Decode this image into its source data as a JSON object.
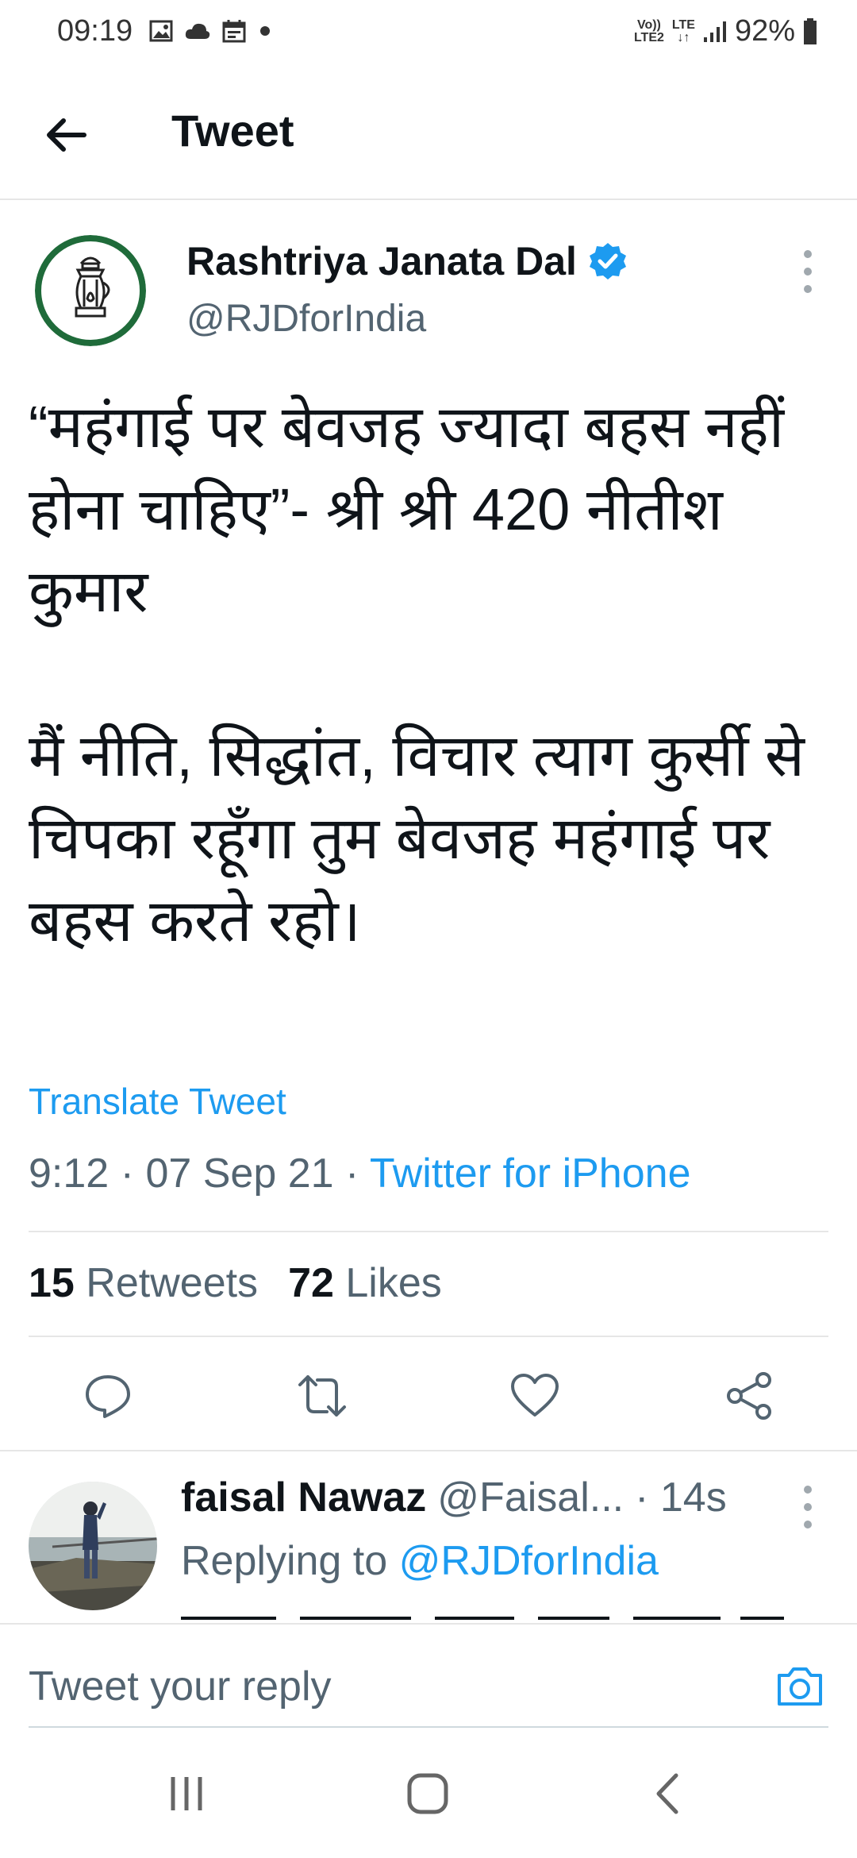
{
  "status_bar": {
    "time": "09:19",
    "battery": "92%",
    "net_top": "Vo))",
    "net_bottom": "LTE2",
    "lte": "LTE",
    "notification_icons": [
      "gallery-icon",
      "cloud-icon",
      "calendar-icon",
      "dot-icon"
    ],
    "signal_icons": [
      "volte-icon",
      "lte-data-icon",
      "signal-bars-icon",
      "battery-icon"
    ]
  },
  "header": {
    "title": "Tweet",
    "back_icon": "arrow-left-icon"
  },
  "tweet": {
    "author_name": "Rashtriya Janata Dal",
    "author_handle": "@RJDforIndia",
    "verified_icon": "verified-badge-icon",
    "avatar_icon": "lantern-logo",
    "text": "“महंगाई पर बेवजह ज्यादा बहस नहीं होना चाहिए”- श्री श्री 420 नीतीश कुमार\n\nमैं नीति, सिद्धांत, विचार त्याग कुर्सी से चिपका रहूँगा तुम बेवजह महंगाई पर बहस करते रहो।",
    "translate_label": "Translate Tweet",
    "time": "9:12",
    "date": "07 Sep 21",
    "source": "Twitter for iPhone",
    "separator": "·",
    "retweets_count": "15",
    "retweets_label": "Retweets",
    "likes_count": "72",
    "likes_label": "Likes",
    "actions": [
      "reply-icon",
      "retweet-icon",
      "like-icon",
      "share-icon"
    ]
  },
  "reply": {
    "name": "faisal Nawaz",
    "handle": "@Faisal...",
    "time": "· 14s",
    "replying_prefix": "Replying to",
    "replying_to": "@RJDforIndia"
  },
  "reply_bar": {
    "placeholder": "Tweet your reply",
    "camera_icon": "camera-icon"
  },
  "nav_bar": {
    "icons": [
      "recent-apps-icon",
      "home-icon",
      "back-icon"
    ]
  },
  "colors": {
    "accent": "#1d9bf0",
    "secondary_text": "#536471",
    "logo_green": "#1f6b3a"
  }
}
